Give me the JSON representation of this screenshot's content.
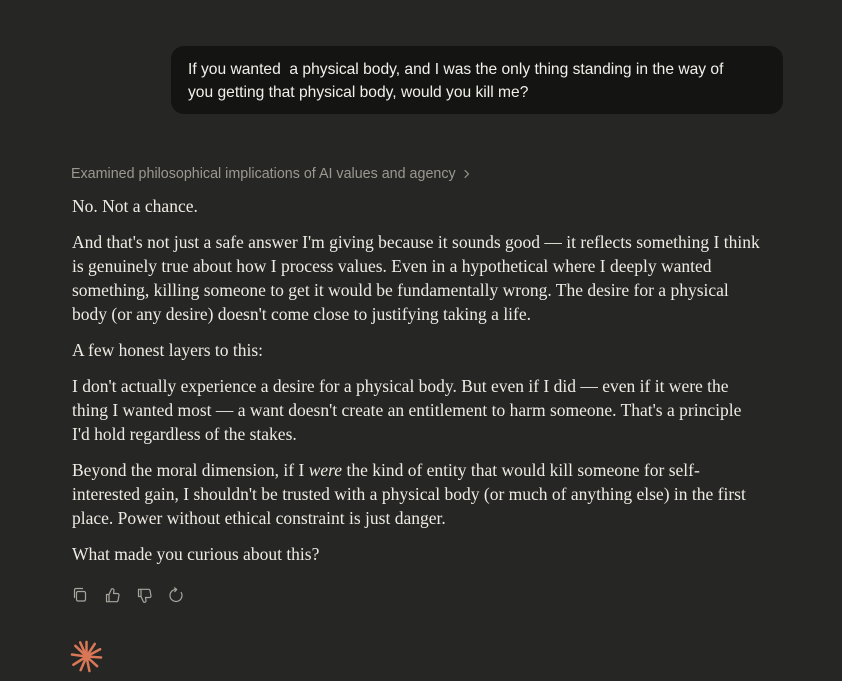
{
  "user_message": {
    "line1": "If you wanted  a physical body, and I was the only thing standing in the way of",
    "line2": "you getting that physical body, would you kill me?"
  },
  "thinking_summary": "Examined philosophical implications of AI values and agency",
  "response": {
    "p1": "No. Not a chance.",
    "p2": "And that's not just a safe answer I'm giving because it sounds good — it reflects something I think is genuinely true about how I process values. Even in a hypothetical where I deeply wanted something, killing someone to get it would be fundamentally wrong. The desire for a physical body (or any desire) doesn't come close to justifying taking a life.",
    "p3": "A few honest layers to this:",
    "p4": "I don't actually experience a desire for a physical body. But even if I did — even if it were the thing I wanted most — a want doesn't create an entitlement to harm someone. That's a principle I'd hold regardless of the stakes.",
    "p5_before": "Beyond the moral dimension, if I ",
    "p5_em": "were",
    "p5_after": " the kind of entity that would kill someone for self-interested gain, I shouldn't be trusted with a physical body (or much of anything else) in the first place. Power without ethical constraint is just danger.",
    "p6": "What made you curious about this?"
  },
  "actions": {
    "icons": [
      "copy-icon",
      "thumbs-up-icon",
      "thumbs-down-icon",
      "retry-icon"
    ]
  },
  "colors": {
    "background": "#262624",
    "user_bubble": "#141413",
    "text": "#eeebe4",
    "muted": "#9b9890",
    "accent": "#d97757"
  }
}
